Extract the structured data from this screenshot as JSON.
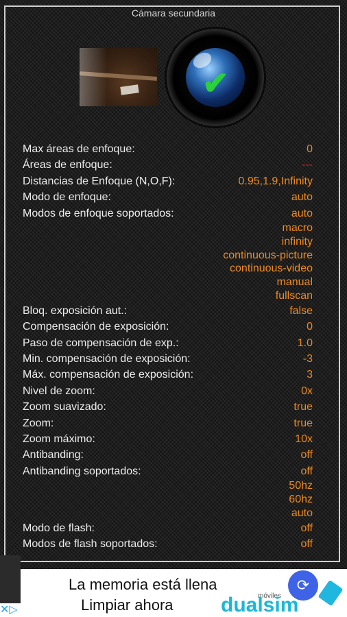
{
  "header": {
    "title": "Cámara secundaria"
  },
  "icons": {
    "camera": "camera-lens-check-icon",
    "preview": "camera-preview-image"
  },
  "rows": [
    {
      "label": "Max áreas de enfoque:",
      "values": [
        "0"
      ]
    },
    {
      "label": "Áreas de enfoque:",
      "values": [
        "---"
      ],
      "red": true
    },
    {
      "label": "Distancias de Enfoque (N,O,F):",
      "values": [
        "0.95,1.9,Infinity"
      ]
    },
    {
      "label": "Modo de enfoque:",
      "values": [
        "auto"
      ]
    },
    {
      "label": "Modos de enfoque soportados:",
      "values": [
        "auto",
        "macro",
        "infinity",
        "continuous-picture",
        "continuous-video",
        "manual",
        "fullscan"
      ]
    },
    {
      "label": "Bloq. exposición aut.:",
      "values": [
        "false"
      ]
    },
    {
      "label": "Compensación de exposición:",
      "values": [
        "0"
      ]
    },
    {
      "label": "Paso de compensación de exp.:",
      "values": [
        "1.0"
      ]
    },
    {
      "label": "Min. compensación de exposición:",
      "values": [
        "-3"
      ]
    },
    {
      "label": "Máx. compensación de exposición:",
      "values": [
        "3"
      ]
    },
    {
      "label": "Nivel de zoom:",
      "values": [
        "0x"
      ]
    },
    {
      "label": "Zoom suavizado:",
      "values": [
        "true"
      ]
    },
    {
      "label": "Zoom:",
      "values": [
        "true"
      ]
    },
    {
      "label": "Zoom máximo:",
      "values": [
        "10x"
      ]
    },
    {
      "label": "Antibanding:",
      "values": [
        "off"
      ]
    },
    {
      "label": "Antibanding soportados:",
      "values": [
        "off",
        "50hz",
        "60hz",
        "auto"
      ]
    },
    {
      "label": "Modo de flash:",
      "values": [
        "off"
      ]
    },
    {
      "label": "Modos de flash soportados:",
      "values": [
        "off"
      ]
    }
  ],
  "ad": {
    "line1": "La memoria está llena",
    "line2": "Limpiar ahora",
    "brand": "dualsim",
    "brand_sub": "móviles",
    "adchoices": "✕▷"
  },
  "colors": {
    "value": "#f08a1e",
    "label": "#ececec",
    "dash": "#e0201a"
  }
}
